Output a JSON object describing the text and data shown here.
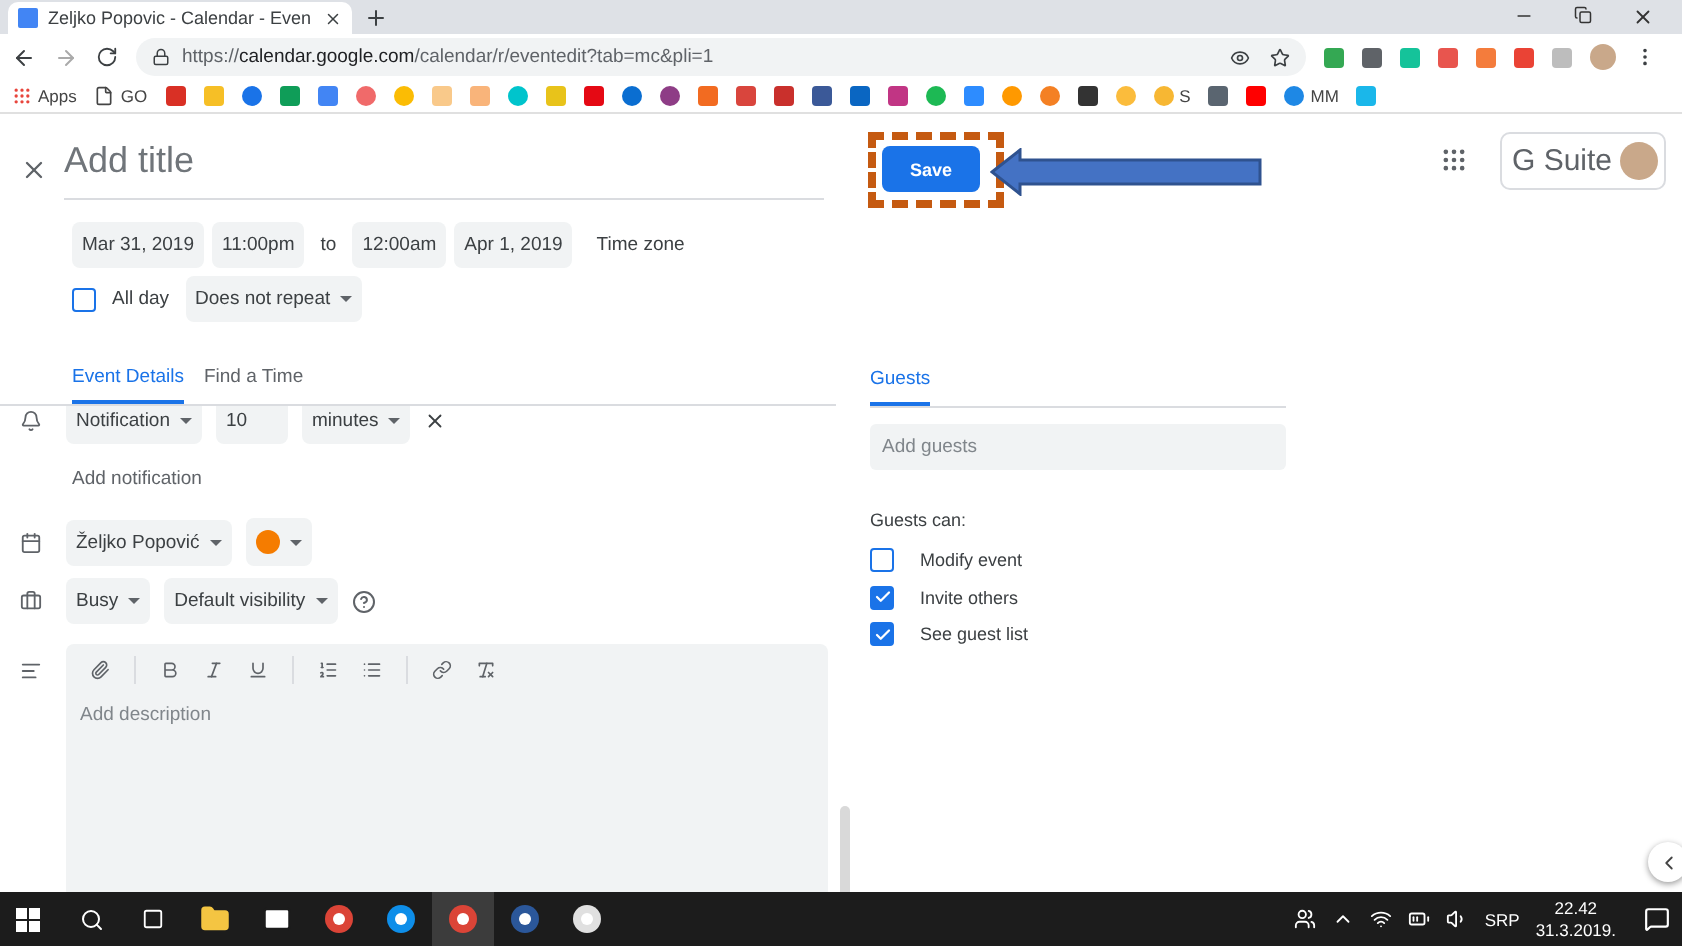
{
  "browser": {
    "tab": {
      "title": "Zeljko Popovic - Calendar - Even",
      "selected": true
    },
    "url": {
      "scheme": "https://",
      "host": "calendar.google.com",
      "path": "/calendar/r/eventedit?tab=mc&pli=1"
    },
    "extensions": [
      {
        "color": "#34a853"
      },
      {
        "color": "#5f6368"
      },
      {
        "color": "#15c39a"
      },
      {
        "color": "#e8554e"
      },
      {
        "color": "#f47c3c"
      },
      {
        "color": "#ea4335"
      },
      {
        "color": "#bdbdbd"
      }
    ],
    "bookmarks": [
      {
        "kind": "apps",
        "label": "Apps"
      },
      {
        "kind": "page",
        "label": "GO"
      },
      {
        "kind": "square",
        "color": "#d93025"
      },
      {
        "kind": "square",
        "color": "#f6bf26"
      },
      {
        "kind": "circle",
        "color": "#1a73e8"
      },
      {
        "kind": "square",
        "color": "#0f9d58"
      },
      {
        "kind": "square",
        "color": "#4285f4"
      },
      {
        "kind": "circle",
        "color": "#f06a6a"
      },
      {
        "kind": "circle",
        "color": "#fbbc04"
      },
      {
        "kind": "square",
        "color": "#f9c98a"
      },
      {
        "kind": "square",
        "color": "#f9b47a"
      },
      {
        "kind": "circle",
        "color": "#00c4cc"
      },
      {
        "kind": "square",
        "color": "#e8c31a"
      },
      {
        "kind": "square",
        "color": "#e50914"
      },
      {
        "kind": "circle",
        "color": "#0a6ed1"
      },
      {
        "kind": "circle",
        "color": "#8e3d86"
      },
      {
        "kind": "square",
        "color": "#f26b21"
      },
      {
        "kind": "square",
        "color": "#d9453d"
      },
      {
        "kind": "square",
        "color": "#c9302c"
      },
      {
        "kind": "square",
        "color": "#3b5998"
      },
      {
        "kind": "square",
        "color": "#0a66c2"
      },
      {
        "kind": "square",
        "color": "#c13584"
      },
      {
        "kind": "circle",
        "color": "#1db954"
      },
      {
        "kind": "square",
        "color": "#2d8cff"
      },
      {
        "kind": "circle",
        "color": "#ff9900"
      },
      {
        "kind": "circle",
        "color": "#f48024"
      },
      {
        "kind": "square",
        "color": "#333333"
      },
      {
        "kind": "circle",
        "color": "#fbbc3c"
      },
      {
        "kind": "circle",
        "color": "#f7b733",
        "label": "S"
      },
      {
        "kind": "square",
        "color": "#5a6570"
      },
      {
        "kind": "square",
        "color": "#ff0000"
      },
      {
        "kind": "circle",
        "color": "#1e88e5",
        "label": "MM"
      },
      {
        "kind": "square",
        "color": "#1ab7ea"
      }
    ]
  },
  "header": {
    "title_placeholder": "Add title",
    "save": "Save",
    "suite": "G Suite"
  },
  "event": {
    "start_date": "Mar 31, 2019",
    "start_time": "11:00pm",
    "to": "to",
    "end_time": "12:00am",
    "end_date": "Apr 1, 2019",
    "time_zone": "Time zone",
    "all_day": {
      "label": "All day",
      "checked": false
    },
    "repeat": "Does not repeat",
    "tabs": [
      {
        "label": "Event Details",
        "selected": true
      },
      {
        "label": "Find a Time",
        "selected": false
      }
    ],
    "notification": {
      "type": "Notification",
      "value": "10",
      "unit": "minutes"
    },
    "add_notification": "Add notification",
    "calendar": {
      "name": "Željko Popović",
      "color": "#f57c00"
    },
    "availability": "Busy",
    "visibility": "Default visibility",
    "description_placeholder": "Add description"
  },
  "guests": {
    "tab": {
      "label": "Guests",
      "selected": true
    },
    "placeholder": "Add guests",
    "permissions_label": "Guests can:",
    "permissions": [
      {
        "label": "Modify event",
        "checked": false
      },
      {
        "label": "Invite others",
        "checked": true
      },
      {
        "label": "See guest list",
        "checked": true
      }
    ]
  },
  "taskbar": {
    "apps": [
      {
        "kind": "explorer",
        "active": false
      },
      {
        "kind": "mail",
        "active": false
      },
      {
        "kind": "chrome",
        "active": false
      },
      {
        "kind": "teamviewer",
        "active": false
      },
      {
        "kind": "chrome",
        "active": true
      },
      {
        "kind": "word",
        "active": false
      },
      {
        "kind": "paint",
        "active": false
      }
    ],
    "language": "SRP",
    "time": "22.42",
    "date": "31.3.2019."
  }
}
